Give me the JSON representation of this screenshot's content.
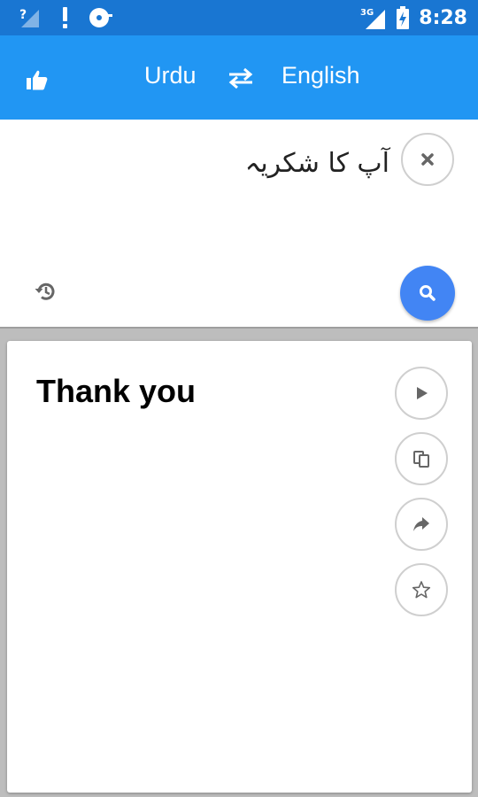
{
  "status_bar": {
    "time": "8:28",
    "network_label": "3G",
    "icons": [
      "signal-unknown-icon",
      "alert-icon",
      "vinyl-icon",
      "signal-3g-icon",
      "battery-charging-icon"
    ]
  },
  "toolbar": {
    "source_language": "Urdu",
    "target_language": "English",
    "icons": [
      "thumbs-up-icon",
      "swap-icon"
    ]
  },
  "input": {
    "text": "آپ کا شکریہ",
    "icons": [
      "clear-icon",
      "history-icon",
      "search-icon"
    ]
  },
  "result": {
    "text": "Thank you",
    "actions": [
      "play-icon",
      "copy-icon",
      "share-icon",
      "star-icon"
    ]
  },
  "colors": {
    "status_bar": "#1976d2",
    "toolbar": "#2196f3",
    "search_button": "#4285f4",
    "background": "#bdbdbd"
  }
}
